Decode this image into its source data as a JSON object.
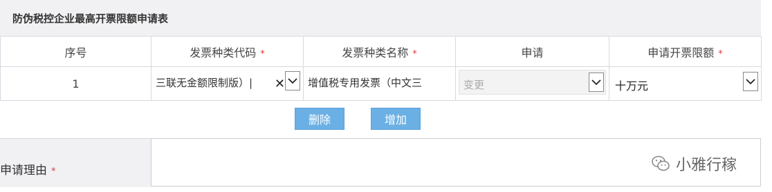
{
  "form": {
    "title": "防伪税控企业最高开票限额申请表",
    "required_mark": "*",
    "columns": [
      "序号",
      "发票种类代码",
      "发票种类名称",
      "申请",
      "申请开票限额"
    ],
    "row": {
      "index": "1",
      "type_code": "三联无金额限制版）|",
      "clear_glyph": "✕",
      "type_name": "增值税专用发票（中文三",
      "apply_value": "变更",
      "limit_value": "十万元"
    },
    "buttons": {
      "delete": "删除",
      "add": "增加"
    },
    "reason_label": "申请理由",
    "reason_value": ""
  },
  "watermark": {
    "text": "小雅行稼",
    "icon": "wechat-icon"
  },
  "colors": {
    "button_bg": "#6ab0e5",
    "required": "#e03a3a",
    "header_bg": "#f1f1f4"
  }
}
